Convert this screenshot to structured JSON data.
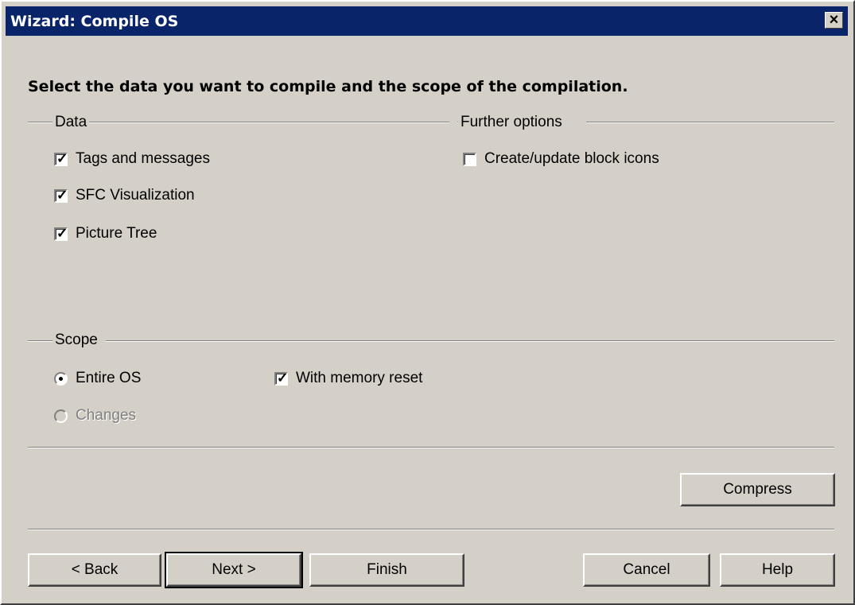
{
  "window": {
    "title": "Wizard: Compile OS",
    "close_label": "✕"
  },
  "headline": "Select the data you want to compile and the scope of the compilation.",
  "data_group": {
    "label": "Data",
    "items": [
      {
        "label": "Tags and messages",
        "checked": true
      },
      {
        "label": "SFC Visualization",
        "checked": true
      },
      {
        "label": "Picture Tree",
        "checked": true
      }
    ]
  },
  "further_group": {
    "label": "Further options",
    "items": [
      {
        "label": "Create/update block icons",
        "checked": false
      }
    ]
  },
  "scope_group": {
    "label": "Scope",
    "entire_os": {
      "label": "Entire OS",
      "selected": true
    },
    "changes": {
      "label": "Changes",
      "selected": false,
      "disabled": true
    },
    "memory_reset": {
      "label": "With memory reset",
      "checked": true
    }
  },
  "buttons": {
    "compress": "Compress",
    "back": "< Back",
    "next": "Next >",
    "finish": "Finish",
    "cancel": "Cancel",
    "help": "Help"
  }
}
